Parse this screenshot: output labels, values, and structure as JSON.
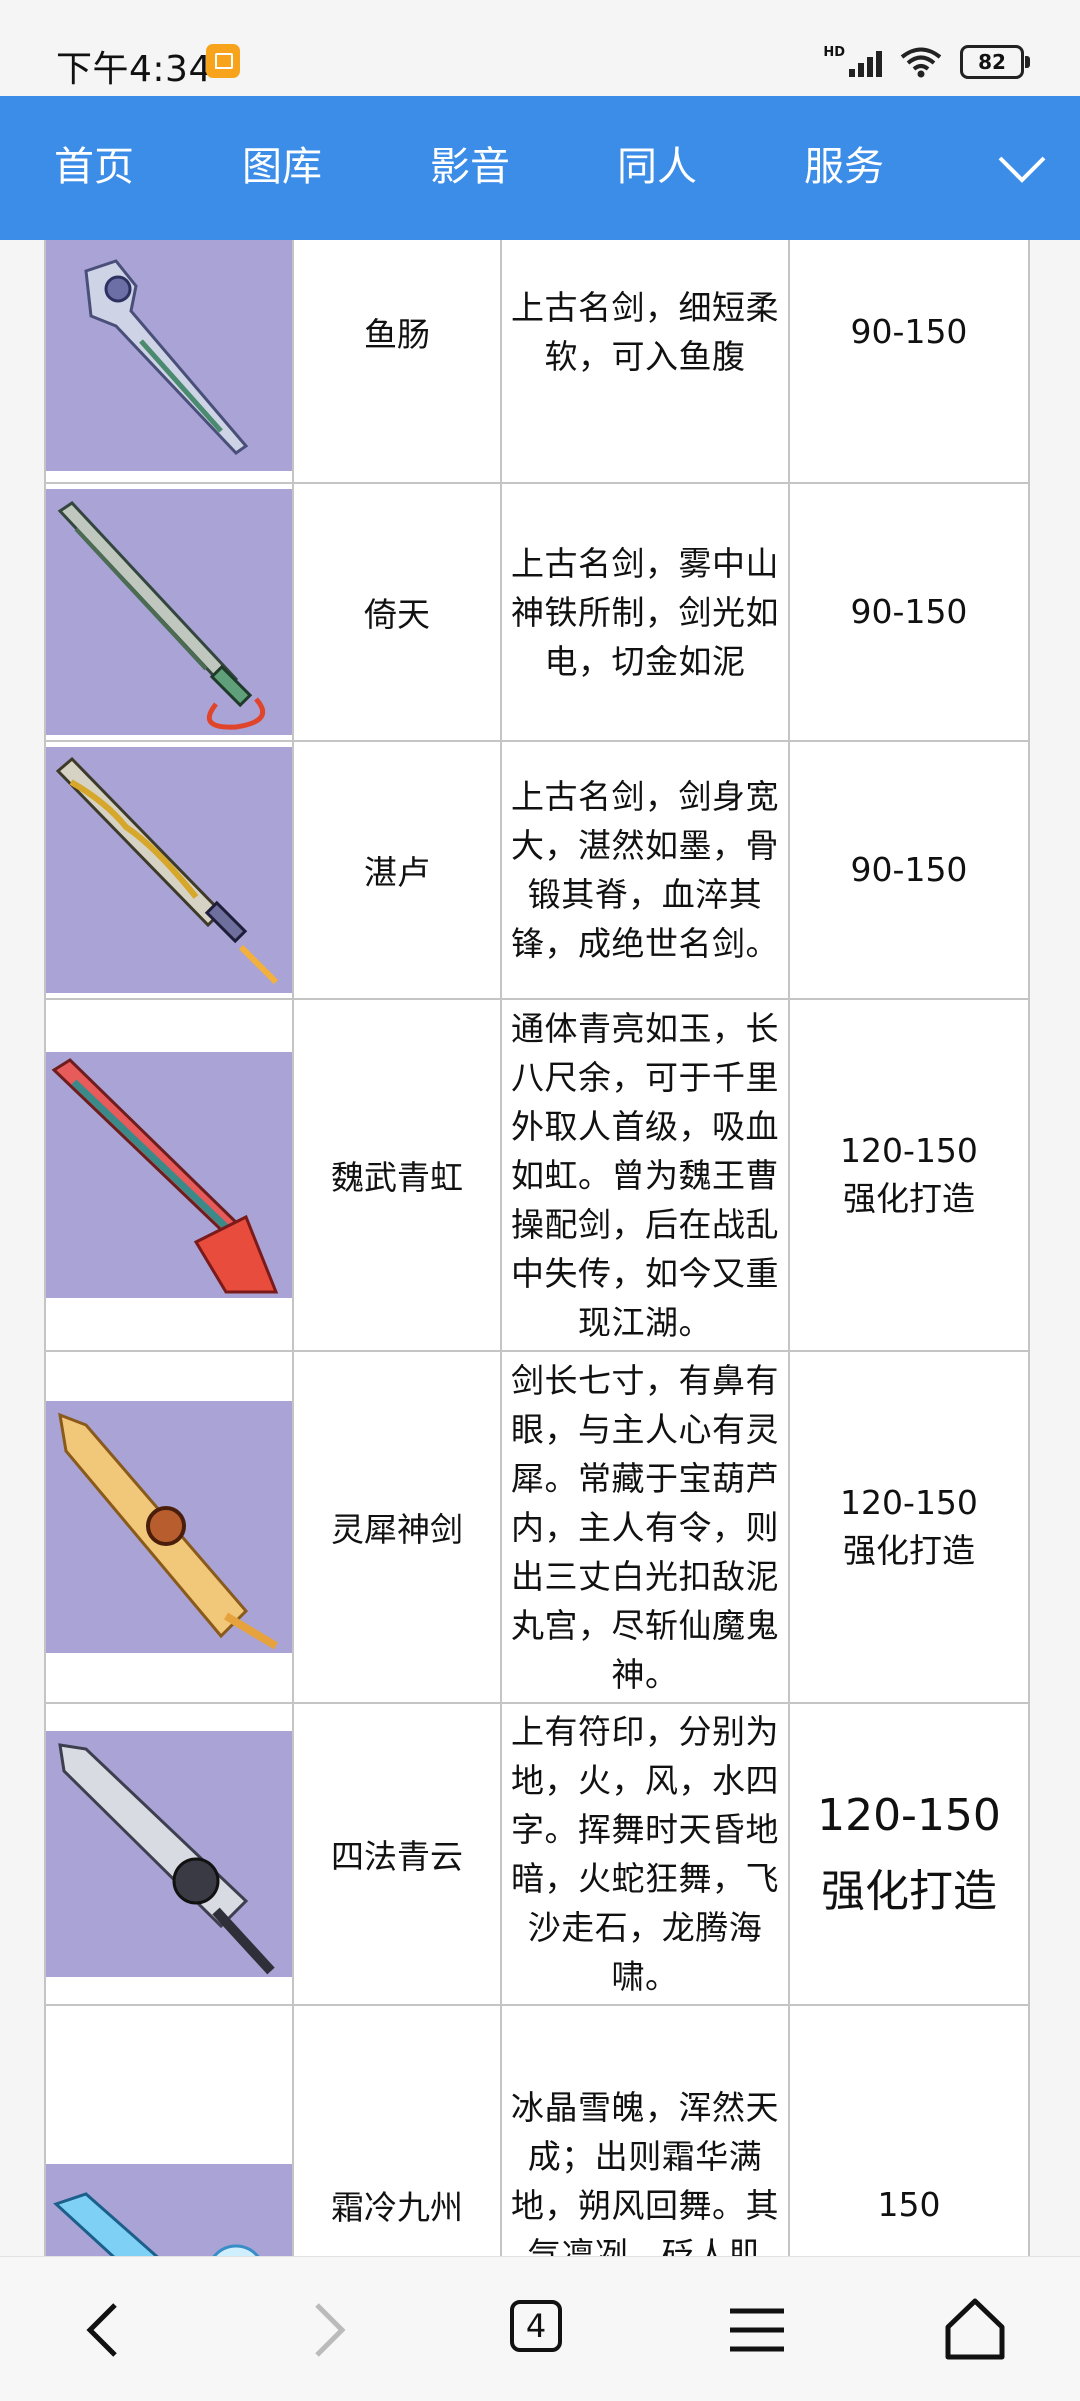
{
  "status": {
    "time": "下午4:34",
    "hd": "HD",
    "battery": "82"
  },
  "nav": {
    "items": [
      "首页",
      "图库",
      "影音",
      "同人",
      "服务"
    ]
  },
  "weapons": [
    {
      "name": "鱼肠",
      "desc": "上古名剑，细短柔软，可入鱼腹",
      "level": "90-150"
    },
    {
      "name": "倚天",
      "desc": "上古名剑，雾中山神铁所制，剑光如电，切金如泥",
      "level": "90-150"
    },
    {
      "name": "湛卢",
      "desc": "上古名剑，剑身宽大，湛然如墨，骨锻其脊，血淬其锋，成绝世名剑。",
      "level": "90-150"
    },
    {
      "name": "魏武青虹",
      "desc": "通体青亮如玉，长八尺余，可于千里外取人首级，吸血如虹。曾为魏王曹操配剑，后在战乱中失传，如今又重现江湖。",
      "level": "120-150",
      "level2": "强化打造"
    },
    {
      "name": "灵犀神剑",
      "desc": "剑长七寸，有鼻有眼，与主人心有灵犀。常藏于宝葫芦内，主人有令，则出三丈白光扣敌泥丸宫，尽斩仙魔鬼神。",
      "level": "120-150",
      "level2": "强化打造"
    },
    {
      "name": "四法青云",
      "desc": "上有符印，分别为地，火，风，水四字。挥舞时天昏地暗，火蛇狂舞，飞沙走石，龙腾海啸。",
      "level": "120-150",
      "level2": "强化打造"
    },
    {
      "name": "霜冷九州",
      "desc": "冰晶雪魄，浑然天成；出则霜华满地，朔风回舞。其气凛冽，砭人肌骨；其意萧条，山",
      "level": "150"
    }
  ],
  "bottom": {
    "tabs_count": "4"
  },
  "colors": {
    "nav_bg": "#3b8de8",
    "thumb_bg": "#a9a3d6",
    "battery_notif": "#f7a41c"
  }
}
